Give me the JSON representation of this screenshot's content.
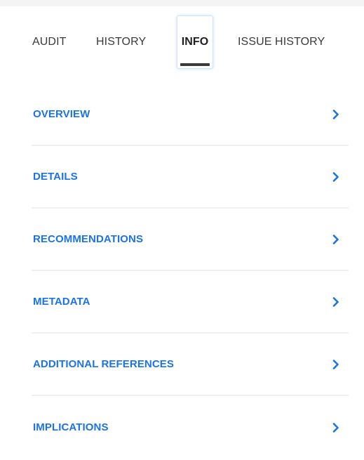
{
  "tabs": [
    {
      "label": "AUDIT",
      "active": false
    },
    {
      "label": "HISTORY",
      "active": false
    },
    {
      "label": "INFO",
      "active": true
    },
    {
      "label": "ISSUE HISTORY",
      "active": false
    }
  ],
  "sections": [
    {
      "label": "OVERVIEW",
      "icon": "chevron-right-icon"
    },
    {
      "label": "DETAILS",
      "icon": "chevron-right-icon"
    },
    {
      "label": "RECOMMENDATIONS",
      "icon": "chevron-right-icon"
    },
    {
      "label": "METADATA",
      "icon": "chevron-right-icon"
    },
    {
      "label": "ADDITIONAL REFERENCES",
      "icon": "chevron-right-icon"
    },
    {
      "label": "IMPLICATIONS",
      "icon": "chevron-right-icon"
    }
  ],
  "colors": {
    "accent": "#1a73e8",
    "tab_text": "#3a3a3a",
    "divider": "#f0f0f0",
    "active_indicator": "#3a3a3a"
  }
}
